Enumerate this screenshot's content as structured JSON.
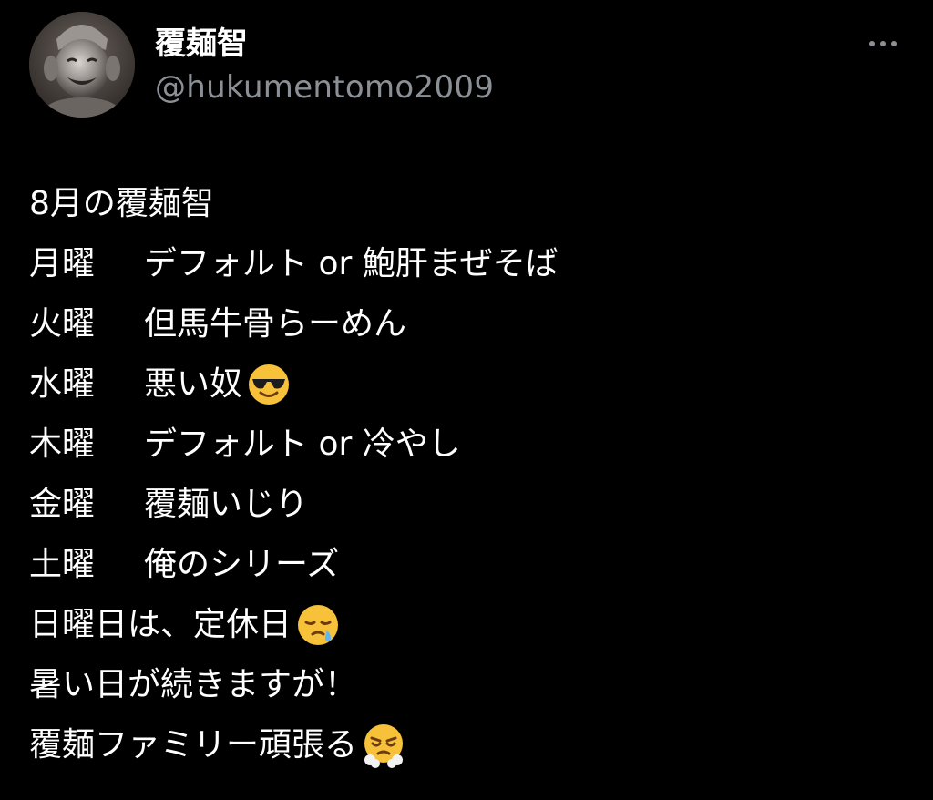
{
  "author": {
    "display_name": "覆麺智",
    "handle": "@hukumentomo2009"
  },
  "tweet": {
    "title_line": "8月の覆麺智",
    "schedule": [
      {
        "day": "月曜",
        "menu": "デフォルト or 鮑肝まぜそば"
      },
      {
        "day": "火曜",
        "menu": "但馬牛骨らーめん"
      },
      {
        "day": "水曜",
        "menu": "悪い奴",
        "emoji": "smiling-face-with-sunglasses-icon"
      },
      {
        "day": "木曜",
        "menu": "デフォルト or 冷やし"
      },
      {
        "day": "金曜",
        "menu": "覆麺いじり"
      },
      {
        "day": "土曜",
        "menu": "俺のシリーズ"
      }
    ],
    "closing_lines": [
      {
        "text": "日曜日は、定休日",
        "emoji": "sleepy-face-icon"
      },
      {
        "text": "暑い日が続きますが！"
      },
      {
        "text": "覆麺ファミリー頑張る",
        "emoji": "face-with-steam-from-nose-icon"
      }
    ]
  },
  "colors": {
    "background": "#000000",
    "text": "#ffffff",
    "secondary_text": "#8b9096"
  }
}
